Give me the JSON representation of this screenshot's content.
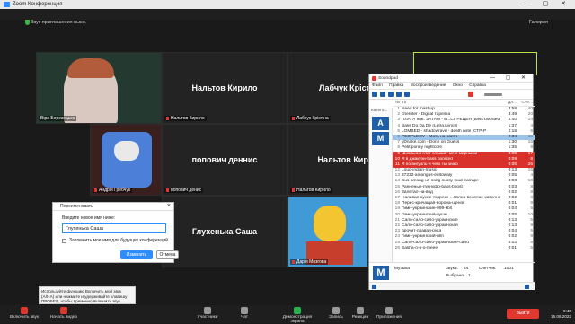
{
  "window": {
    "title": "Zoom Конференция",
    "security_text": "Звук приглашения выкл.",
    "view_button": "Галерея"
  },
  "colors": {
    "accent": "#2d8cff",
    "danger": "#e0382f",
    "soundpad_blue": "#1f5fa8",
    "active_speaker": "#b7e24a"
  },
  "tiles": [
    {
      "label": "Віра Березецька",
      "name": "",
      "type": "video"
    },
    {
      "label": "Нальтов Кирило",
      "name": "Нальтов Кирило",
      "type": "name"
    },
    {
      "label": "Лабчук Крістіна",
      "name": "Лабчук Крістіна",
      "type": "name"
    },
    {
      "label": "Андрій Гребчук",
      "name": "",
      "type": "avatar"
    },
    {
      "label": "попович денис",
      "name": "попович деннис",
      "type": "name"
    },
    {
      "label": "Нальтов Кирило",
      "name": "Нальтов Кирило",
      "type": "name"
    },
    {
      "label": "",
      "name": "",
      "type": "empty"
    },
    {
      "label": "",
      "name": "Глухенька Саша",
      "type": "name"
    },
    {
      "label": "Дарія Мозгова",
      "name": "",
      "type": "avatar"
    }
  ],
  "rename_dialog": {
    "title": "Переименовать",
    "prompt": "Введите новое имя ниже:",
    "value": "Глухенька Саша",
    "checkbox_label": "Запомнить мое имя для будущих конференций",
    "rename_button": "Изменить",
    "cancel_button": "Отмена"
  },
  "tooltip": "Используйте функцию Включить мой звук (Alt+A) или нажмите и удерживайте клавишу ПРОБЕЛ, чтобы временно включить звук.",
  "controls": {
    "unmute": "Включить звук",
    "video": "Начать видео",
    "participants": "Участники",
    "participants_count": "10",
    "chat": "Чат",
    "share": "Демонстрация экрана",
    "record": "Запись",
    "reactions": "Реакции",
    "apps": "Приложения",
    "end": "Выйти",
    "time": "9:40",
    "date": "16.06.2022"
  },
  "soundpad": {
    "title": "Soundpad",
    "menu": [
      "Файл",
      "Правка",
      "Воспроизведение",
      "Окно",
      "Справка"
    ],
    "headers": {
      "num": "№",
      "title": "Tit",
      "dur": "Дл...",
      "plays": "Сче..."
    },
    "categories_header": "Катего...",
    "category_letters": [
      "A",
      "M"
    ],
    "rows": [
      {
        "n": "1",
        "t": "Need for mashup",
        "d": "3:58",
        "p": "40",
        "h": ""
      },
      {
        "n": "2",
        "t": "chernter - Digital тарелка",
        "d": "3:49",
        "p": "20",
        "h": ""
      },
      {
        "n": "3",
        "t": "ПЛАГА feat. ЗАТАМ - В...СПРЕЦЕН [bass boosted]",
        "d": "2:40",
        "p": "24",
        "h": ""
      },
      {
        "n": "4",
        "t": "Bass Do Da De (Letra,Lyrics)",
        "d": "1:37",
        "p": "4",
        "h": ""
      },
      {
        "n": "5",
        "t": "LOMBED - shadowrave - death note [СТР-Р",
        "d": "2:18",
        "p": "6",
        "h": ""
      },
      {
        "n": "6",
        "t": "PEOPLEOV - Мать на авито",
        "d": "2:34",
        "p": "16",
        "h": "blue"
      },
      {
        "n": "7",
        "t": "уDnake.com - Done on Guess",
        "d": "1:30",
        "p": "15",
        "h": ""
      },
      {
        "n": "8",
        "t": "Petit poney nightcore",
        "d": "1:35",
        "p": "9",
        "h": ""
      },
      {
        "n": "9",
        "t": "Школьник-глот слышит мем-мирными",
        "d": "0:09",
        "p": "17",
        "h": "red"
      },
      {
        "n": "10",
        "t": "Я в джакузи-bass boosted",
        "d": "0:09",
        "p": "8",
        "h": "red"
      },
      {
        "n": "11",
        "t": "Я по вигуэль-я чего ты знаю",
        "d": "0:06",
        "p": "26",
        "h": "red"
      },
      {
        "n": "12",
        "t": "Loud-indian-music",
        "d": "0:13",
        "p": "15",
        "h": ""
      },
      {
        "n": "13",
        "t": "37232-amongus-editowaly",
        "d": "0:05",
        "p": "4",
        "h": ""
      },
      {
        "n": "14",
        "t": "Sus-among-us-song-sussy-loud-earrape",
        "d": "0:03",
        "p": "10",
        "h": ""
      },
      {
        "n": "15",
        "t": "Ранненые-пукнуфр-bass-boost",
        "d": "0:03",
        "p": "8",
        "h": ""
      },
      {
        "n": "16",
        "t": "Залетал-на-вод",
        "d": "0:02",
        "p": "9",
        "h": ""
      },
      {
        "n": "17",
        "t": "Наливая-кухне-торрекс-...полно-веселое-кабачнне",
        "d": "0:02",
        "p": "8",
        "h": ""
      },
      {
        "n": "18",
        "t": "Перес-кричащая-ворона-щенок",
        "d": "0:01",
        "p": "9",
        "h": ""
      },
      {
        "n": "19",
        "t": "Гимн-украинские-999-kbs",
        "d": "0:04",
        "p": "5",
        "h": ""
      },
      {
        "n": "20",
        "t": "Гимн-украинский-чушк",
        "d": "0:05",
        "p": "10",
        "h": ""
      },
      {
        "n": "21",
        "t": "Сало-сало-сало-украинские",
        "d": "0:13",
        "p": "5",
        "h": ""
      },
      {
        "n": "22",
        "t": "Сало-сало-сало-украинская",
        "d": "0:13",
        "p": "9",
        "h": ""
      },
      {
        "n": "23",
        "t": "дрочит-правая-рука",
        "d": "0:04",
        "p": "5",
        "h": ""
      },
      {
        "n": "24",
        "t": "Гимн-украинский-ulm",
        "d": "0:02",
        "p": "9",
        "h": ""
      },
      {
        "n": "25",
        "t": "Сало-сало-сало-украинские-сало",
        "d": "0:03",
        "p": "5",
        "h": ""
      },
      {
        "n": "26",
        "t": "Sasha-o-o-o-meee",
        "d": "0:01",
        "p": "5",
        "h": ""
      }
    ],
    "bottom": {
      "letter": "M",
      "name": "Музыка",
      "sounds_label": "Звуки:",
      "sounds": "24",
      "dur_label": "Длит.",
      "dur": "58",
      "played_label": "Счетчик:",
      "played": "1001",
      "selected_label": "Выбрано:",
      "selected": "1"
    }
  }
}
